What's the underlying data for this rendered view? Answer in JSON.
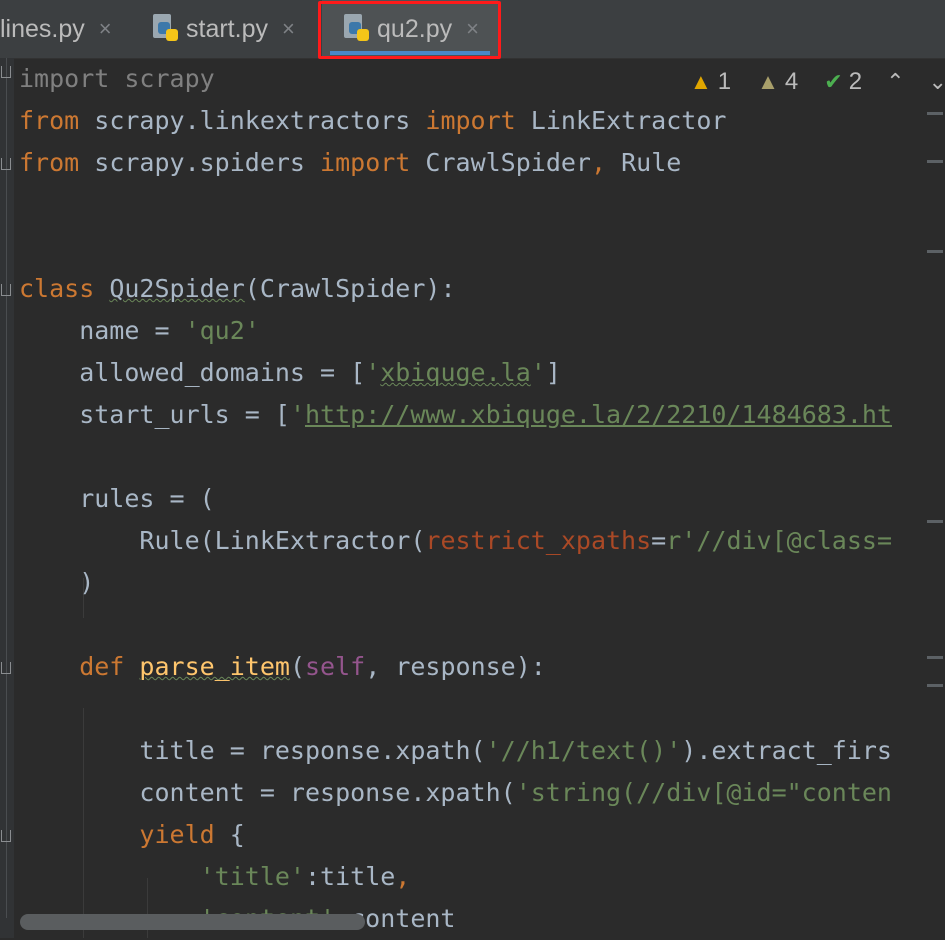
{
  "tabs": [
    {
      "label": "lines.py",
      "close": "×"
    },
    {
      "label": "start.py",
      "close": "×"
    },
    {
      "label": "qu2.py",
      "close": "×"
    }
  ],
  "inspections": {
    "warnings": "1",
    "weak_warnings": "4",
    "ok": "2"
  },
  "code": {
    "l1": "import scrapy",
    "l2_from": "from",
    "l2_mod": " scrapy.linkextractors ",
    "l2_import": "import",
    "l2_name": " LinkExtractor",
    "l3_from": "from",
    "l3_mod": " scrapy.spiders ",
    "l3_import": "import",
    "l3_name": " CrawlSpider",
    "l3_comma": ",",
    "l3_name2": " Rule",
    "l6_class": "class",
    "l6_name": "Qu2Spider",
    "l6_rest": "(CrawlSpider):",
    "l7_name": "    name = ",
    "l7_val": "'qu2'",
    "l8_name": "    allowed_domains = [",
    "l8_q1": "'",
    "l8_val": "xbiquge.la",
    "l8_q2": "'",
    "l8_end": "]",
    "l9_name": "    start_urls = [",
    "l9_q": "'",
    "l9_val": "http://www.xbiquge.la/2/2210/1484683.ht",
    "l11": "    rules = (",
    "l12_a": "        Rule(LinkExtractor(",
    "l12_param": "restrict_xpaths",
    "l12_eq": "=",
    "l12_val": "r'//div[@class=",
    "l13": "    )",
    "l15_def": "    def ",
    "l15_fn": "parse_item",
    "l15_a": "(",
    "l15_self": "self",
    "l15_b": ", response):",
    "l17_a": "        title = response.xpath(",
    "l17_val": "'//h1/text()'",
    "l17_b": ").extract_firs",
    "l18_a": "        content = response.xpath(",
    "l18_val": "'string(//div[@id=\"conten",
    "l19_kw": "        yield ",
    "l19_b": "{",
    "l20_val": "            'title'",
    "l20_b": ":title",
    "l20_c": ",",
    "l21_val": "            'content'",
    "l21_b": ":content"
  }
}
